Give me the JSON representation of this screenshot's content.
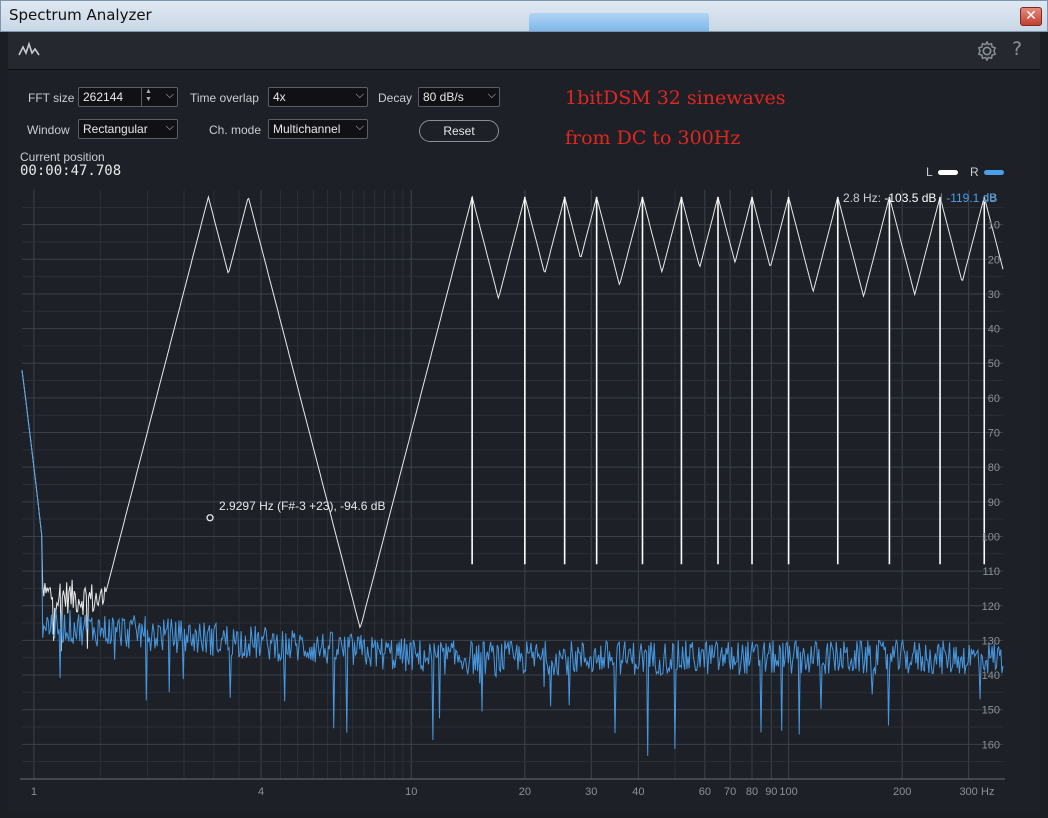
{
  "window": {
    "title": "Spectrum Analyzer",
    "close_label": "✕"
  },
  "toolbar": {
    "help_label": "?"
  },
  "controls": {
    "fft_size": {
      "label": "FFT size",
      "value": "262144"
    },
    "time_overlap": {
      "label": "Time overlap",
      "value": "4x"
    },
    "decay": {
      "label": "Decay",
      "value": "80 dB/s"
    },
    "window": {
      "label": "Window",
      "value": "Rectangular"
    },
    "ch_mode": {
      "label": "Ch. mode",
      "value": "Multichannel"
    },
    "reset_label": "Reset"
  },
  "annotation": {
    "line1": "1bitDSM  32 sinewaves",
    "line2": "from DC to 300Hz",
    "color": "#e0261e"
  },
  "current_position": {
    "label": "Current position",
    "value": "00:00:47.708"
  },
  "legend": {
    "left_label": "L",
    "right_label": "R",
    "left_color": "#ffffff",
    "right_color": "#4a9eea"
  },
  "readout": {
    "prefix": "2.8 Hz: ",
    "left_value": "-103.5 dB",
    "sep": " | ",
    "right_value": "-119.1 dB"
  },
  "marker": {
    "text": "2.9297 Hz (F#-3 +23), -94.6 dB",
    "freq": 2.9297,
    "db": -94.6
  },
  "chart_data": {
    "type": "line",
    "x_scale": "log",
    "xlim": [
      0.93,
      370
    ],
    "ylim": [
      0,
      -170
    ],
    "y_unit": "dB",
    "x_unit": "Hz",
    "x_ticks": [
      {
        "v": 1,
        "label": "1"
      },
      {
        "v": 4,
        "label": "4"
      },
      {
        "v": 10,
        "label": "10"
      },
      {
        "v": 20,
        "label": "20"
      },
      {
        "v": 30,
        "label": "30"
      },
      {
        "v": 40,
        "label": "40"
      },
      {
        "v": 60,
        "label": "60"
      },
      {
        "v": 70,
        "label": "70"
      },
      {
        "v": 80,
        "label": "80"
      },
      {
        "v": 90,
        "label": "90"
      },
      {
        "v": 100,
        "label": "100"
      },
      {
        "v": 200,
        "label": "200"
      },
      {
        "v": 300,
        "label": "300"
      }
    ],
    "y_ticks": [
      -10,
      -20,
      -30,
      -40,
      -50,
      -60,
      -70,
      -80,
      -90,
      -100,
      -110,
      -120,
      -130,
      -140,
      -150,
      -160
    ],
    "peak_freqs_hz": [
      2.9,
      3.7,
      14.5,
      20,
      25.5,
      31,
      41,
      52,
      65,
      80,
      100,
      135,
      185,
      252,
      330
    ],
    "peak_level_db": -2,
    "series": [
      {
        "name": "L",
        "color": "#ffffff",
        "noise_floor_db": -128
      },
      {
        "name": "R",
        "color": "#4a9eea",
        "noise_floor_db": -135
      }
    ]
  }
}
